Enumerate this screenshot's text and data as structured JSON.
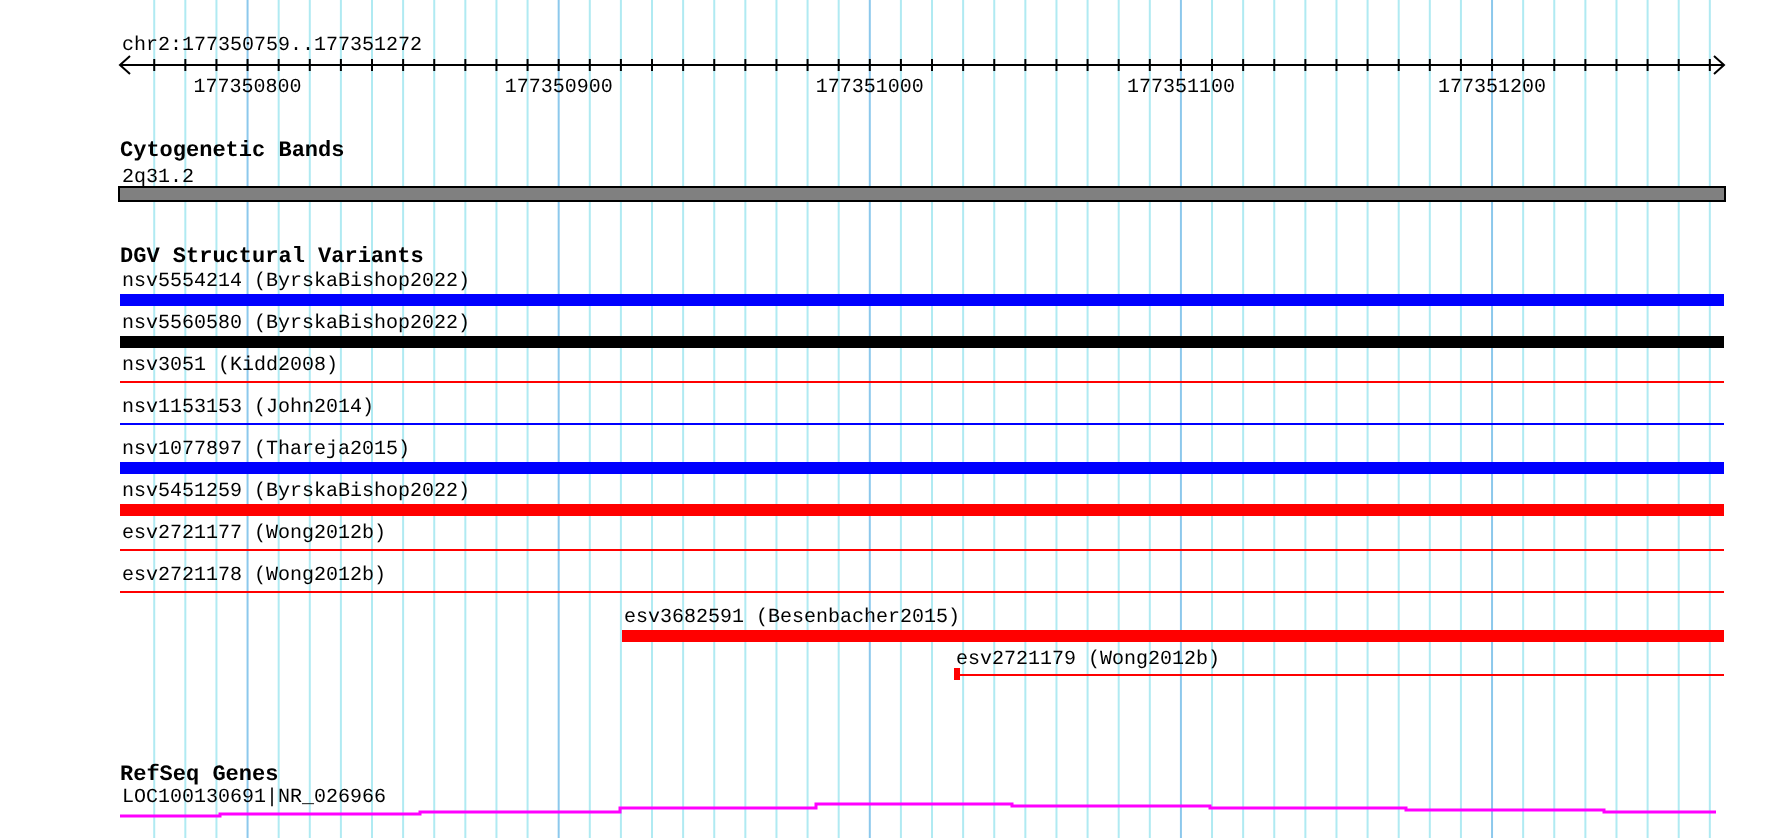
{
  "ruler": {
    "title": "chr2:177350759..177351272",
    "labels": [
      "177350800",
      "177350900",
      "177351000",
      "177351100",
      "177351200"
    ]
  },
  "cytobands": {
    "title": "Cytogenetic Bands",
    "label": "2q31.2"
  },
  "variants": {
    "title": "DGV Structural Variants",
    "features": [
      {
        "label": "nsv5554214 (ByrskaBishop2022)",
        "color": "#0000ff",
        "kind": "thick"
      },
      {
        "label": "nsv5560580 (ByrskaBishop2022)",
        "color": "#000000",
        "kind": "thick"
      },
      {
        "label": "nsv3051 (Kidd2008)",
        "color": "#ff0000",
        "kind": "thin"
      },
      {
        "label": "nsv1153153 (John2014)",
        "color": "#0000ff",
        "kind": "thin"
      },
      {
        "label": "nsv1077897 (Thareja2015)",
        "color": "#0000ff",
        "kind": "thick"
      },
      {
        "label": "nsv5451259 (ByrskaBishop2022)",
        "color": "#ff0000",
        "kind": "thick"
      },
      {
        "label": "esv2721177 (Wong2012b)",
        "color": "#ff0000",
        "kind": "thin"
      },
      {
        "label": "esv2721178 (Wong2012b)",
        "color": "#ff0000",
        "kind": "thin"
      },
      {
        "label": "esv3682591 (Besenbacher2015)",
        "color": "#ff0000",
        "kind": "thick"
      },
      {
        "label": "esv2721179 (Wong2012b)",
        "color": "#ff0000",
        "kind": "thin-marked"
      }
    ]
  },
  "genes": {
    "title": "RefSeq Genes",
    "label": "LOC100130691|NR_026966"
  }
}
